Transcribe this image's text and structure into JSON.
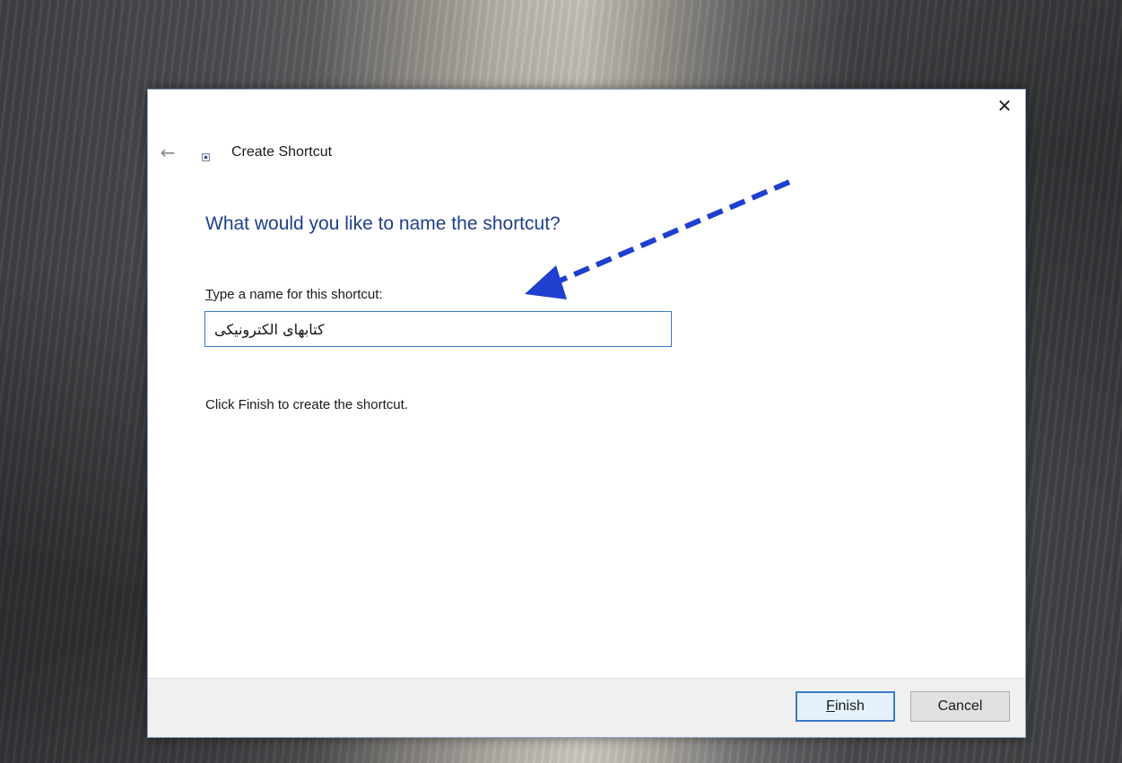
{
  "dialog": {
    "close_glyph": "✕",
    "back_glyph": "←",
    "title": "Create Shortcut",
    "heading": "What would you like to name the shortcut?",
    "field_label_mnemonic": "T",
    "field_label_rest": "ype a name for this shortcut:",
    "name_value": "کتابهای الکترونیکی",
    "hint": "Click Finish to create the shortcut.",
    "finish_mnemonic": "F",
    "finish_rest": "inish",
    "cancel_label": "Cancel"
  },
  "annotation": {
    "arrow_color": "#1f3fcf",
    "arrow_style": "dashed"
  }
}
